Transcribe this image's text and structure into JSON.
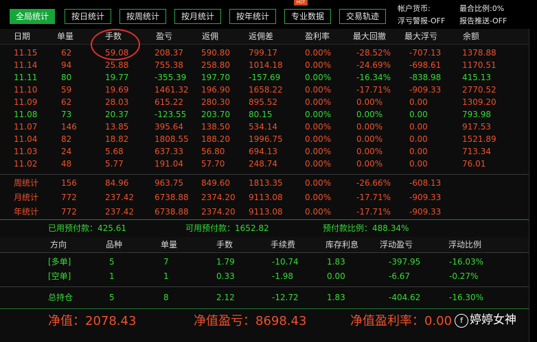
{
  "toolbar": {
    "buttons": [
      "全局统计",
      "按日统计",
      "按周统计",
      "按月统计",
      "按年统计",
      "专业数据",
      "交易轨迹"
    ],
    "active_index": 0,
    "hot_badge": "HOT",
    "account_currency": "帐户货币:",
    "margin_ratio": "最合比例:0%",
    "float_alert": "浮亏警报-OFF",
    "report_push": "报告推送-OFF"
  },
  "daily_table": {
    "headers": [
      "日期",
      "单量",
      "手数",
      "盈亏",
      "返佣",
      "返佣差",
      "盈利率",
      "最大回撤",
      "最大浮亏",
      "余额"
    ],
    "rows": [
      {
        "tone": "red",
        "cells": [
          "11.15",
          "62",
          "59.08",
          "208.37",
          "590.80",
          "799.17",
          "0.00%",
          "-28.52%",
          "-707.13",
          "1378.88"
        ]
      },
      {
        "tone": "red",
        "cells": [
          "11.14",
          "94",
          "25.88",
          "755.38",
          "258.80",
          "1014.18",
          "0.00%",
          "-24.69%",
          "-698.61",
          "1170.51"
        ]
      },
      {
        "tone": "green",
        "cells": [
          "11.11",
          "80",
          "19.77",
          "-355.39",
          "197.70",
          "-157.69",
          "0.00%",
          "-16.34%",
          "-838.98",
          "415.13"
        ]
      },
      {
        "tone": "red",
        "cells": [
          "11.10",
          "59",
          "19.69",
          "1461.32",
          "196.90",
          "1658.22",
          "0.00%",
          "-17.71%",
          "-909.33",
          "2770.52"
        ]
      },
      {
        "tone": "red",
        "cells": [
          "11.09",
          "62",
          "28.03",
          "615.22",
          "280.30",
          "895.52",
          "0.00%",
          "0.00%",
          "0.00",
          "1309.20"
        ]
      },
      {
        "tone": "green",
        "cells": [
          "11.08",
          "73",
          "20.37",
          "-123.55",
          "203.70",
          "80.15",
          "0.00%",
          "0.00%",
          "0.00",
          "793.98"
        ]
      },
      {
        "tone": "red",
        "cells": [
          "11.07",
          "146",
          "13.85",
          "395.64",
          "138.50",
          "534.14",
          "0.00%",
          "0.00%",
          "0.00",
          "917.53"
        ]
      },
      {
        "tone": "red",
        "cells": [
          "11.04",
          "82",
          "18.82",
          "1808.55",
          "188.20",
          "1996.75",
          "0.00%",
          "0.00%",
          "0.00",
          "1521.89"
        ]
      },
      {
        "tone": "red",
        "cells": [
          "11.03",
          "24",
          "5.68",
          "637.33",
          "56.80",
          "694.13",
          "0.00%",
          "0.00%",
          "0.00",
          "713.34"
        ]
      },
      {
        "tone": "red",
        "cells": [
          "11.02",
          "48",
          "5.77",
          "191.04",
          "57.70",
          "248.74",
          "0.00%",
          "0.00%",
          "0.00",
          "76.01"
        ]
      }
    ]
  },
  "period_stats": [
    {
      "cells": [
        "周统计",
        "156",
        "84.96",
        "963.75",
        "849.60",
        "1813.35",
        "0.00%",
        "-26.66%",
        "-608.13"
      ]
    },
    {
      "cells": [
        "月统计",
        "772",
        "237.42",
        "6738.88",
        "2374.20",
        "9113.08",
        "0.00%",
        "-17.71%",
        "-909.33"
      ]
    },
    {
      "cells": [
        "年统计",
        "772",
        "237.42",
        "6738.88",
        "2374.20",
        "9113.08",
        "0.00%",
        "-17.71%",
        "-909.33"
      ]
    }
  ],
  "margin": {
    "used": "已用预付款：425.61",
    "available": "可用预付款：1652.82",
    "ratio": "预付款比例：488.34%"
  },
  "positions": {
    "headers": [
      "方向",
      "品种",
      "单量",
      "手数",
      "手续费",
      "库存利息",
      "浮动盈亏",
      "浮动比例"
    ],
    "rows": [
      {
        "cells": [
          "[多单]",
          "5",
          "7",
          "1.79",
          "-10.74",
          "1.83",
          "-397.95",
          "-16.03%"
        ]
      },
      {
        "cells": [
          "[空单]",
          "1",
          "1",
          "0.33",
          "-1.98",
          "0.00",
          "-6.67",
          "-0.27%"
        ]
      }
    ],
    "total": {
      "cells": [
        "总持仓",
        "5",
        "8",
        "2.12",
        "-12.72",
        "1.83",
        "-404.62",
        "-16.30%"
      ]
    }
  },
  "summary": {
    "net_value": "净值：2078.43",
    "net_profit": "净值盈亏：8698.43",
    "net_rate": "净值盈利率：0.00"
  },
  "watermark": {
    "logo": "f",
    "text": "婷婷女神"
  },
  "colors": {
    "accent_green": "#16a53a",
    "profit_red": "#f0512a",
    "loss_green": "#33dd33"
  }
}
